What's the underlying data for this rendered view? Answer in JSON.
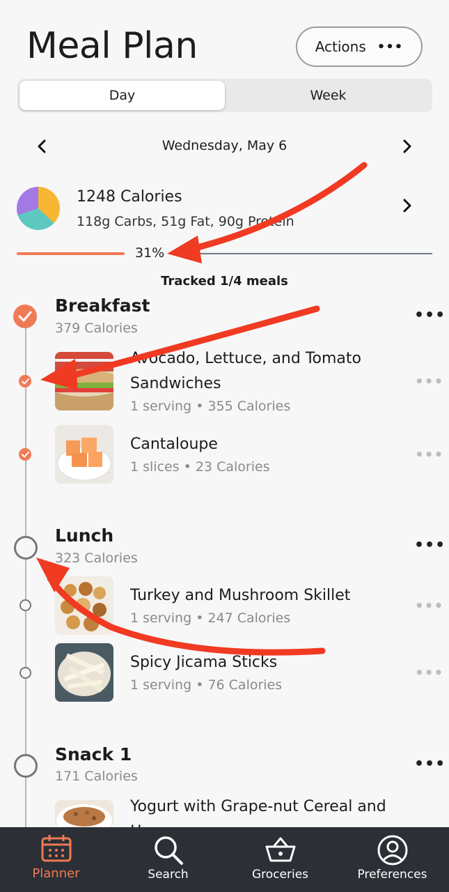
{
  "header": {
    "title": "Meal Plan",
    "actions_label": "Actions",
    "actions_icon": "ellipsis-icon"
  },
  "view_toggle": {
    "day": "Day",
    "week": "Week",
    "selected": "Day"
  },
  "date_nav": {
    "label": "Wednesday, May 6"
  },
  "summary": {
    "calories": "1248 Calories",
    "macros": "118g Carbs, 51g Fat, 90g Protein",
    "macro_split": {
      "carbs_pct": 37,
      "fat_pct": 33,
      "protein_pct": 30
    },
    "progress_label": "31%",
    "progress_value": 0.31,
    "tracked_label": "Tracked 1/4 meals"
  },
  "meals": [
    {
      "title": "Breakfast",
      "calories": "379 Calories",
      "done": true,
      "items": [
        {
          "name_line1": "Avocado, Lettuce, and Tomato",
          "name_line2": "Sandwiches",
          "meta": "1 serving • 355 Calories",
          "done": true
        },
        {
          "name_line1": "Cantaloupe",
          "meta": "1 slices • 23 Calories",
          "done": true
        }
      ]
    },
    {
      "title": "Lunch",
      "calories": "323 Calories",
      "done": false,
      "items": [
        {
          "name_line1": "Turkey and Mushroom Skillet",
          "meta": "1 serving • 247 Calories",
          "done": false
        },
        {
          "name_line1": "Spicy Jicama Sticks",
          "meta": "1 serving • 76 Calories",
          "done": false
        }
      ]
    },
    {
      "title": "Snack 1",
      "calories": "171 Calories",
      "done": false,
      "items": [
        {
          "name_line1": "Yogurt with Grape-nut Cereal and",
          "name_line2": "H...",
          "done": false
        }
      ]
    }
  ],
  "tabbar": {
    "active": "Planner",
    "tabs": [
      {
        "label": "Planner",
        "icon": "calendar-icon"
      },
      {
        "label": "Search",
        "icon": "search-icon"
      },
      {
        "label": "Groceries",
        "icon": "basket-icon"
      },
      {
        "label": "Preferences",
        "icon": "user-icon"
      }
    ]
  },
  "colors": {
    "accent": "#f07a55",
    "annotation_arrow": "#f03a22",
    "tabbar_bg": "#2c2f36"
  }
}
